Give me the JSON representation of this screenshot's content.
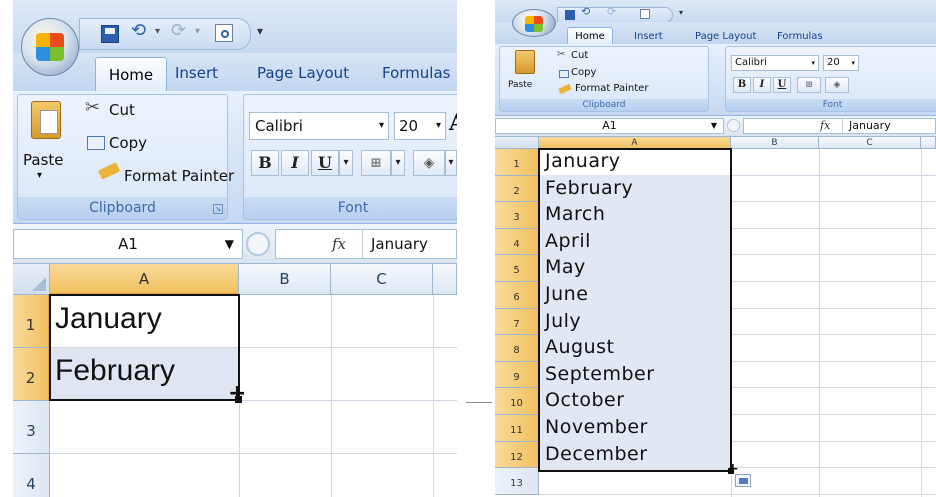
{
  "left": {
    "tabs": [
      "Home",
      "Insert",
      "Page Layout",
      "Formulas"
    ],
    "clipboard": {
      "paste": "Paste",
      "cut": "Cut",
      "copy": "Copy",
      "format_painter": "Format Painter",
      "group_label": "Clipboard"
    },
    "font": {
      "name": "Calibri",
      "size": "20",
      "group_label": "Font",
      "bold": "B",
      "italic": "I",
      "underline": "U"
    },
    "name_box": "A1",
    "fx": "fx",
    "formula_value": "January",
    "columns": [
      "A",
      "B",
      "C"
    ],
    "rows": [
      "1",
      "2",
      "3",
      "4"
    ],
    "cells": [
      "January",
      "February"
    ]
  },
  "right": {
    "tabs": [
      "Home",
      "Insert",
      "Page Layout",
      "Formulas"
    ],
    "clipboard": {
      "paste": "Paste",
      "cut": "Cut",
      "copy": "Copy",
      "format_painter": "Format Painter",
      "group_label": "Clipboard"
    },
    "font": {
      "name": "Calibri",
      "size": "20",
      "group_label": "Font",
      "bold": "B",
      "italic": "I",
      "underline": "U"
    },
    "name_box": "A1",
    "fx": "fx",
    "formula_value": "January",
    "columns": [
      "A",
      "B",
      "C"
    ],
    "rows": [
      "1",
      "2",
      "3",
      "4",
      "5",
      "6",
      "7",
      "8",
      "9",
      "10",
      "11",
      "12",
      "13"
    ],
    "cells": [
      "January",
      "February",
      "March",
      "April",
      "May",
      "June",
      "July",
      "August",
      "September",
      "October",
      "November",
      "December"
    ]
  },
  "colors": {
    "selection_header": "#f1c15f",
    "ribbon": "#dbe6f4",
    "fill_handle": "#000000"
  }
}
